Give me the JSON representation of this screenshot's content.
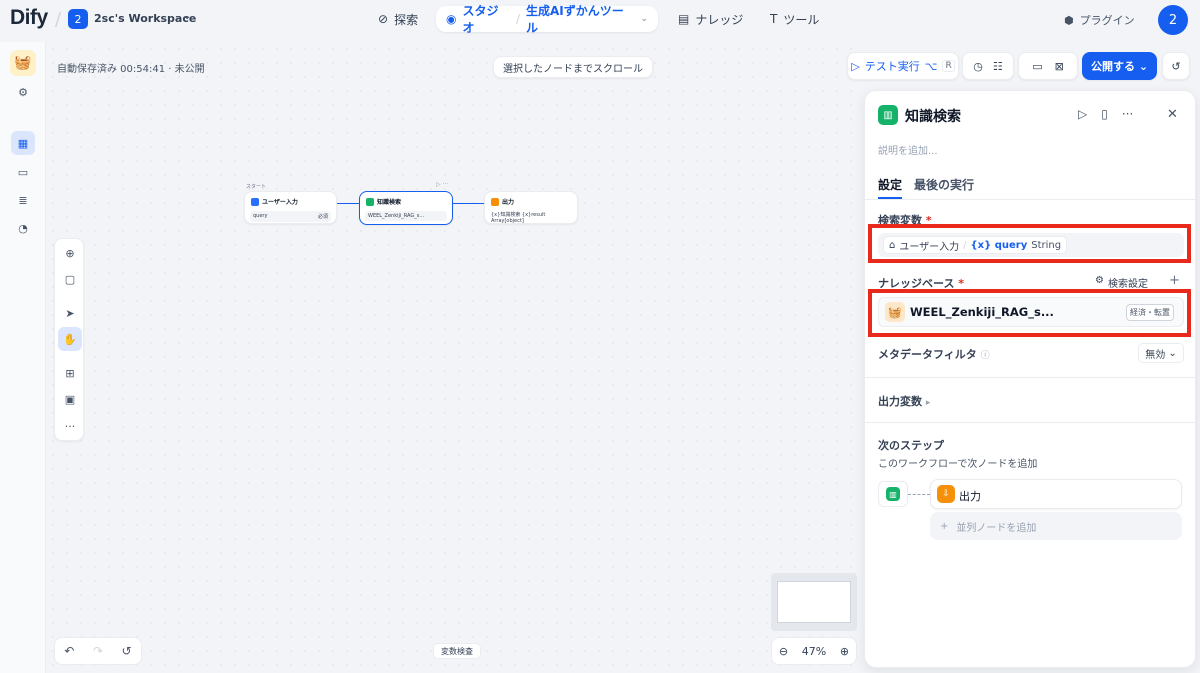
{
  "header": {
    "logo_text": "Dify",
    "workspace_badge": "2",
    "workspace_name": "2sc's Workspace",
    "nav": {
      "explore": "探索",
      "studio": "スタジオ",
      "app_name": "生成AIずかんツール",
      "knowledge": "ナレッジ",
      "tools": "ツール"
    },
    "plugin": "プラグイン",
    "avatar": "2"
  },
  "canvas": {
    "autosave": "自動保存済み 00:54:41 · 未公開",
    "scroll_button": "選択したノードまでスクロール",
    "test_run": "テスト実行",
    "test_shortcut_1": "⌥",
    "test_shortcut_2": "R",
    "publish": "公開する",
    "start_tag": "スタート",
    "nodes": {
      "start": {
        "title": "ユーザー入力",
        "var": "query",
        "badge": "必須"
      },
      "knowledge": {
        "title": "知識検索",
        "kb": "WEEL_Zenkiji_RAG_s..."
      },
      "output": {
        "title": "出力",
        "value": "{x}知識検索 {x}result Array[object]"
      }
    },
    "var_check": "変数検査",
    "zoom": "47%"
  },
  "panel": {
    "title": "知識検索",
    "description_placeholder": "説明を追加...",
    "tabs": [
      "設定",
      "最後の実行"
    ],
    "query_label": "検索変数",
    "query_source": "ユーザー入力",
    "query_var": "{x} query",
    "query_type": "String",
    "kb_label": "ナレッジベース",
    "kb_settings": "検索設定",
    "kb_name": "WEEL_Zenkiji_RAG_s...",
    "kb_tag": "経済・転置",
    "metadata_label": "メタデータフィルタ",
    "metadata_value": "無効",
    "output_label": "出力変数",
    "next_label": "次のステップ",
    "next_desc": "このワークフローで次ノードを追加",
    "next_node": "出力",
    "add_parallel": "並列ノードを追加"
  },
  "colors": {
    "accent": "#155eef",
    "highlight": "#e8291c",
    "knowledge": "#17b26a",
    "output": "#f79009"
  }
}
